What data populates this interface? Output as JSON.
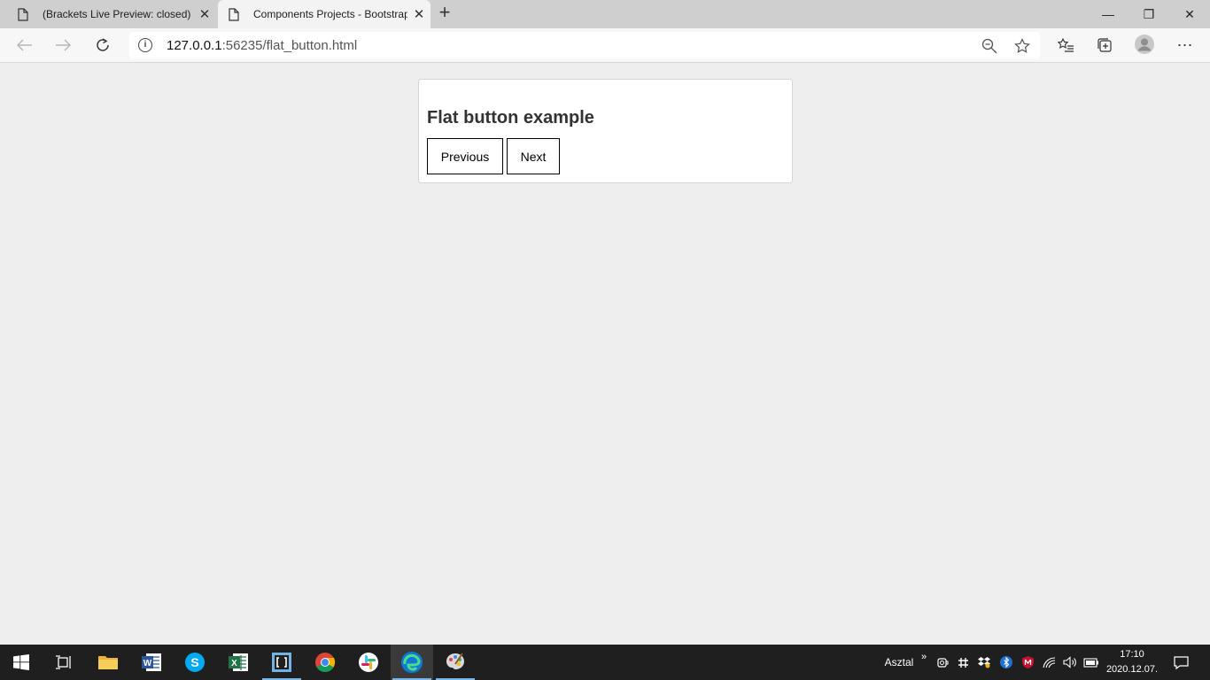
{
  "browser": {
    "tabs": [
      {
        "title": "(Brackets Live Preview: closed) Kö",
        "close": "✕"
      },
      {
        "title": "Components Projects - Bootstrap",
        "close": "✕"
      }
    ],
    "new_tab": "+",
    "window_controls": {
      "minimize": "—",
      "maximize": "❐",
      "close": "✕"
    },
    "address": {
      "host": "127.0.0.1",
      "rest": ":56235/flat_button.html",
      "info": "i"
    },
    "more": "⋯"
  },
  "page": {
    "heading": "Flat button example",
    "buttons": {
      "previous": "Previous",
      "next": "Next"
    }
  },
  "taskbar": {
    "apps": [
      "windows-start",
      "task-view",
      "file-explorer",
      "word",
      "skype",
      "excel",
      "brackets",
      "chrome",
      "slack",
      "edge",
      "paint"
    ],
    "desktop_label": "Asztal",
    "chevron": "»",
    "time": "17:10",
    "date": "2020.12.07."
  },
  "colors": {
    "page_bg": "#eeeeee",
    "tabstrip_bg": "#cfcfcf",
    "taskbar_bg": "#1f1f1f",
    "button_border": "#000000"
  }
}
